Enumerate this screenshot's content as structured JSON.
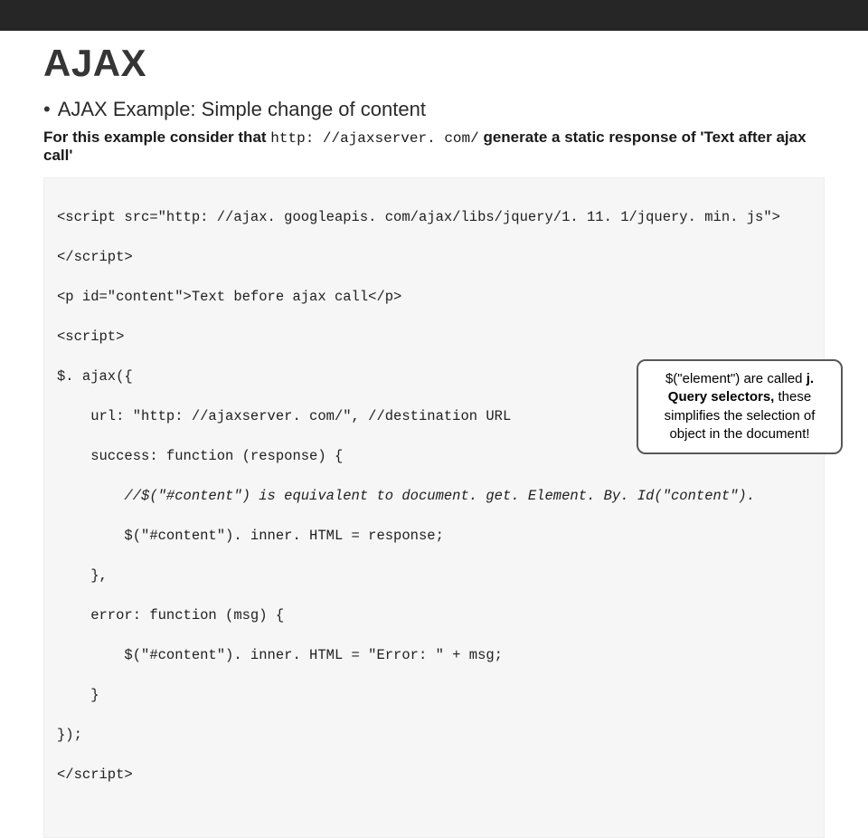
{
  "slide": {
    "title": "AJAX",
    "bullet": "AJAX Example: Simple change of content",
    "desc_pre": "For this example consider that ",
    "desc_code": "http: //ajaxserver. com/",
    "desc_post": " generate a static response of 'Text after ajax call'"
  },
  "code": {
    "l01": "<script src=\"http: //ajax. googleapis. com/ajax/libs/jquery/1. 11. 1/jquery. min. js\">",
    "l02": "</script>",
    "l03": "<p id=\"content\">Text before ajax call</p>",
    "l04": "<script>",
    "l05": "$. ajax({",
    "l06": "    url: \"http: //ajaxserver. com/\", //destination URL",
    "l07": "    success: function (response) {",
    "l08": "        //$(\"#content\") is equivalent to document. get. Element. By. Id(\"content\").",
    "l09": "        $(\"#content\"). inner. HTML = response;",
    "l10": "    },",
    "l11": "    error: function (msg) {",
    "l12": "        $(\"#content\"). inner. HTML = \"Error: \" + msg;",
    "l13": "    }",
    "l14": "});",
    "l15": "</script>"
  },
  "callout": {
    "part1": "$(\"element\") are called ",
    "part2_bold": "j. Query selectors,",
    "part3": " these simplifies the selection of object in the document!"
  }
}
